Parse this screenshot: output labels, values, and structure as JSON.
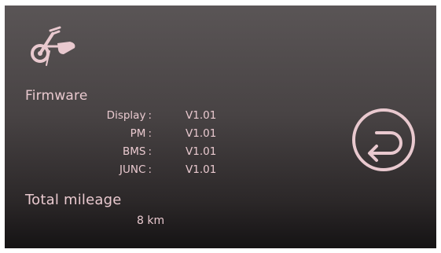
{
  "header": {
    "icon": "handbike-icon"
  },
  "firmware": {
    "title": "Firmware",
    "rows": [
      {
        "label": "Display",
        "colon": ":",
        "value": "V1.01"
      },
      {
        "label": "PM",
        "colon": ":",
        "value": "V1.01"
      },
      {
        "label": "BMS",
        "colon": ":",
        "value": "V1.01"
      },
      {
        "label": "JUNC",
        "colon": ":",
        "value": "V1.01"
      }
    ]
  },
  "mileage": {
    "title": "Total mileage",
    "value": "8 km"
  },
  "navigation": {
    "back_icon": "return-arrow-icon"
  },
  "colors": {
    "accent": "#e9c9cf",
    "background_top": "#5a5556",
    "background_bottom": "#151314"
  }
}
